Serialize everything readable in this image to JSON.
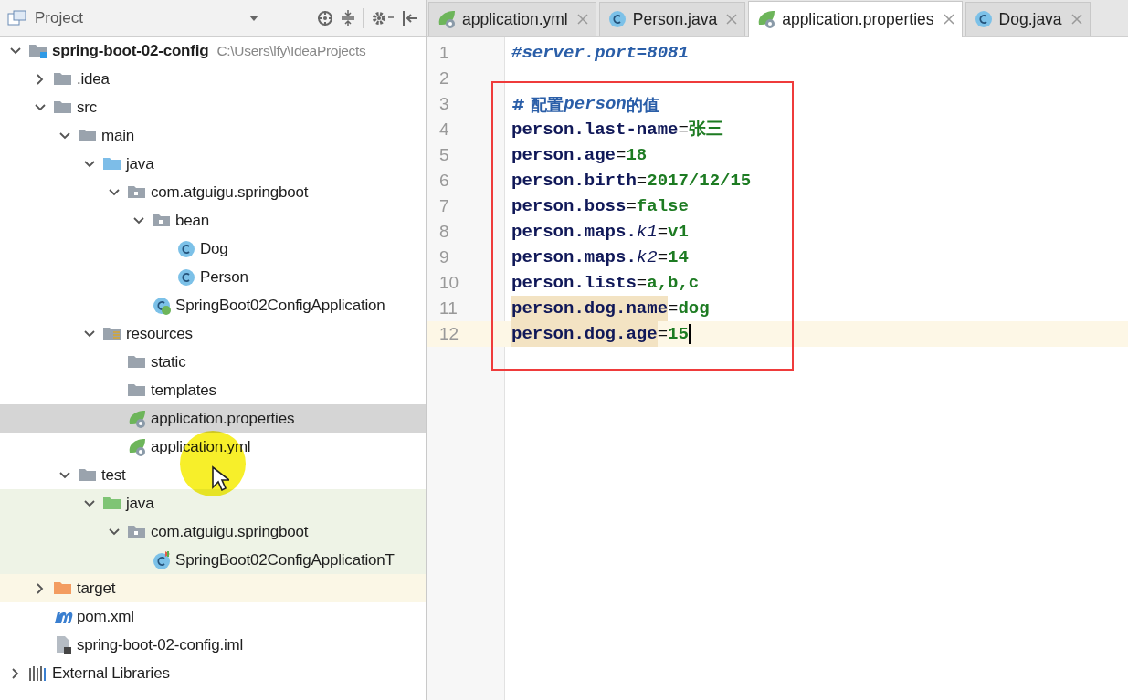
{
  "project_panel": {
    "title": "Project"
  },
  "tree": [
    {
      "label": "spring-boot-02-config",
      "note": "C:\\Users\\lfy\\IdeaProjects",
      "kind": "module",
      "expanded": true,
      "selected": false,
      "children": [
        {
          "label": ".idea",
          "kind": "folder",
          "expanded": false,
          "selected": false
        },
        {
          "label": "src",
          "kind": "folder",
          "expanded": true,
          "selected": false,
          "children": [
            {
              "label": "main",
              "kind": "folder",
              "expanded": true,
              "selected": false,
              "children": [
                {
                  "label": "java",
                  "kind": "source-folder",
                  "expanded": true,
                  "selected": false,
                  "children": [
                    {
                      "label": "com.atguigu.springboot",
                      "kind": "package",
                      "expanded": true,
                      "selected": false,
                      "children": [
                        {
                          "label": "bean",
                          "kind": "package",
                          "expanded": true,
                          "selected": false,
                          "children": [
                            {
                              "label": "Dog",
                              "kind": "class",
                              "selected": false
                            },
                            {
                              "label": "Person",
                              "kind": "class",
                              "selected": false
                            }
                          ]
                        },
                        {
                          "label": "SpringBoot02ConfigApplication",
                          "kind": "spring-class",
                          "selected": false
                        }
                      ]
                    }
                  ]
                },
                {
                  "label": "resources",
                  "kind": "resources-folder",
                  "expanded": true,
                  "selected": false,
                  "children": [
                    {
                      "label": "static",
                      "kind": "folder",
                      "selected": false
                    },
                    {
                      "label": "templates",
                      "kind": "folder",
                      "selected": false
                    },
                    {
                      "label": "application.properties",
                      "kind": "spring-config",
                      "selected": true
                    },
                    {
                      "label": "application.yml",
                      "kind": "spring-config",
                      "selected": false
                    }
                  ]
                }
              ]
            },
            {
              "label": "test",
              "kind": "folder",
              "expanded": true,
              "selected": false,
              "children": [
                {
                  "label": "java",
                  "kind": "test-folder",
                  "expanded": true,
                  "selected": false,
                  "children": [
                    {
                      "label": "com.atguigu.springboot",
                      "kind": "test-package",
                      "expanded": true,
                      "selected": false,
                      "children": [
                        {
                          "label": "SpringBoot02ConfigApplicationT",
                          "kind": "test-class",
                          "selected": false
                        }
                      ]
                    }
                  ]
                }
              ]
            }
          ]
        },
        {
          "label": "target",
          "kind": "excluded-folder",
          "expanded": false,
          "selected": false
        },
        {
          "label": "pom.xml",
          "kind": "maven",
          "selected": false
        },
        {
          "label": "spring-boot-02-config.iml",
          "kind": "iml",
          "selected": false
        }
      ]
    },
    {
      "label": "External Libraries",
      "kind": "libraries",
      "expanded": false,
      "selected": false
    }
  ],
  "tabs": [
    {
      "label": "application.yml",
      "kind": "spring-config",
      "selected": false
    },
    {
      "label": "Person.java",
      "kind": "class",
      "selected": false
    },
    {
      "label": "application.properties",
      "kind": "spring-config",
      "selected": true
    },
    {
      "label": "Dog.java",
      "kind": "class",
      "selected": false
    }
  ],
  "editor": {
    "lines": [
      {
        "number": "1",
        "current": false,
        "tokens": [
          {
            "kind": "comment-italic",
            "text": "#server.port=8081"
          }
        ]
      },
      {
        "number": "2",
        "current": false
      },
      {
        "number": "3",
        "current": false,
        "tokens": [
          {
            "kind": "comment",
            "text": "# 配置"
          },
          {
            "kind": "comment-italic",
            "text": "person"
          },
          {
            "kind": "comment",
            "text": "的值"
          }
        ]
      },
      {
        "number": "4",
        "current": false,
        "tokens": [
          {
            "kind": "key",
            "text": "person.last-name"
          },
          {
            "kind": "sep",
            "text": "="
          },
          {
            "kind": "value",
            "text": "张三"
          }
        ]
      },
      {
        "number": "5",
        "current": false,
        "tokens": [
          {
            "kind": "key",
            "text": "person.age"
          },
          {
            "kind": "sep",
            "text": "="
          },
          {
            "kind": "value",
            "text": "18"
          }
        ]
      },
      {
        "number": "6",
        "current": false,
        "tokens": [
          {
            "kind": "key",
            "text": "person.birth"
          },
          {
            "kind": "sep",
            "text": "="
          },
          {
            "kind": "value",
            "text": "2017/12/15"
          }
        ]
      },
      {
        "number": "7",
        "current": false,
        "tokens": [
          {
            "kind": "key",
            "text": "person.boss"
          },
          {
            "kind": "sep",
            "text": "="
          },
          {
            "kind": "value",
            "text": "false"
          }
        ]
      },
      {
        "number": "8",
        "current": false,
        "tokens": [
          {
            "kind": "key",
            "text": "person.maps."
          },
          {
            "kind": "key-italic",
            "text": "k1"
          },
          {
            "kind": "sep",
            "text": "="
          },
          {
            "kind": "value",
            "text": "v1"
          }
        ]
      },
      {
        "number": "9",
        "current": false,
        "tokens": [
          {
            "kind": "key",
            "text": "person.maps."
          },
          {
            "kind": "key-italic",
            "text": "k2"
          },
          {
            "kind": "sep",
            "text": "="
          },
          {
            "kind": "value",
            "text": "14"
          }
        ]
      },
      {
        "number": "10",
        "current": false,
        "tokens": [
          {
            "kind": "key",
            "text": "person.lists"
          },
          {
            "kind": "sep",
            "text": "="
          },
          {
            "kind": "value",
            "text": "a,b,c"
          }
        ]
      },
      {
        "number": "11",
        "current": false,
        "tokens": [
          {
            "kind": "key-match",
            "text": "person.dog.name"
          },
          {
            "kind": "sep",
            "text": "="
          },
          {
            "kind": "value",
            "text": "dog"
          }
        ]
      },
      {
        "number": "12",
        "current": true,
        "tokens": [
          {
            "kind": "key-match",
            "text": "person.dog.age"
          },
          {
            "kind": "sep",
            "text": "="
          },
          {
            "kind": "value",
            "text": "15"
          }
        ]
      }
    ]
  }
}
